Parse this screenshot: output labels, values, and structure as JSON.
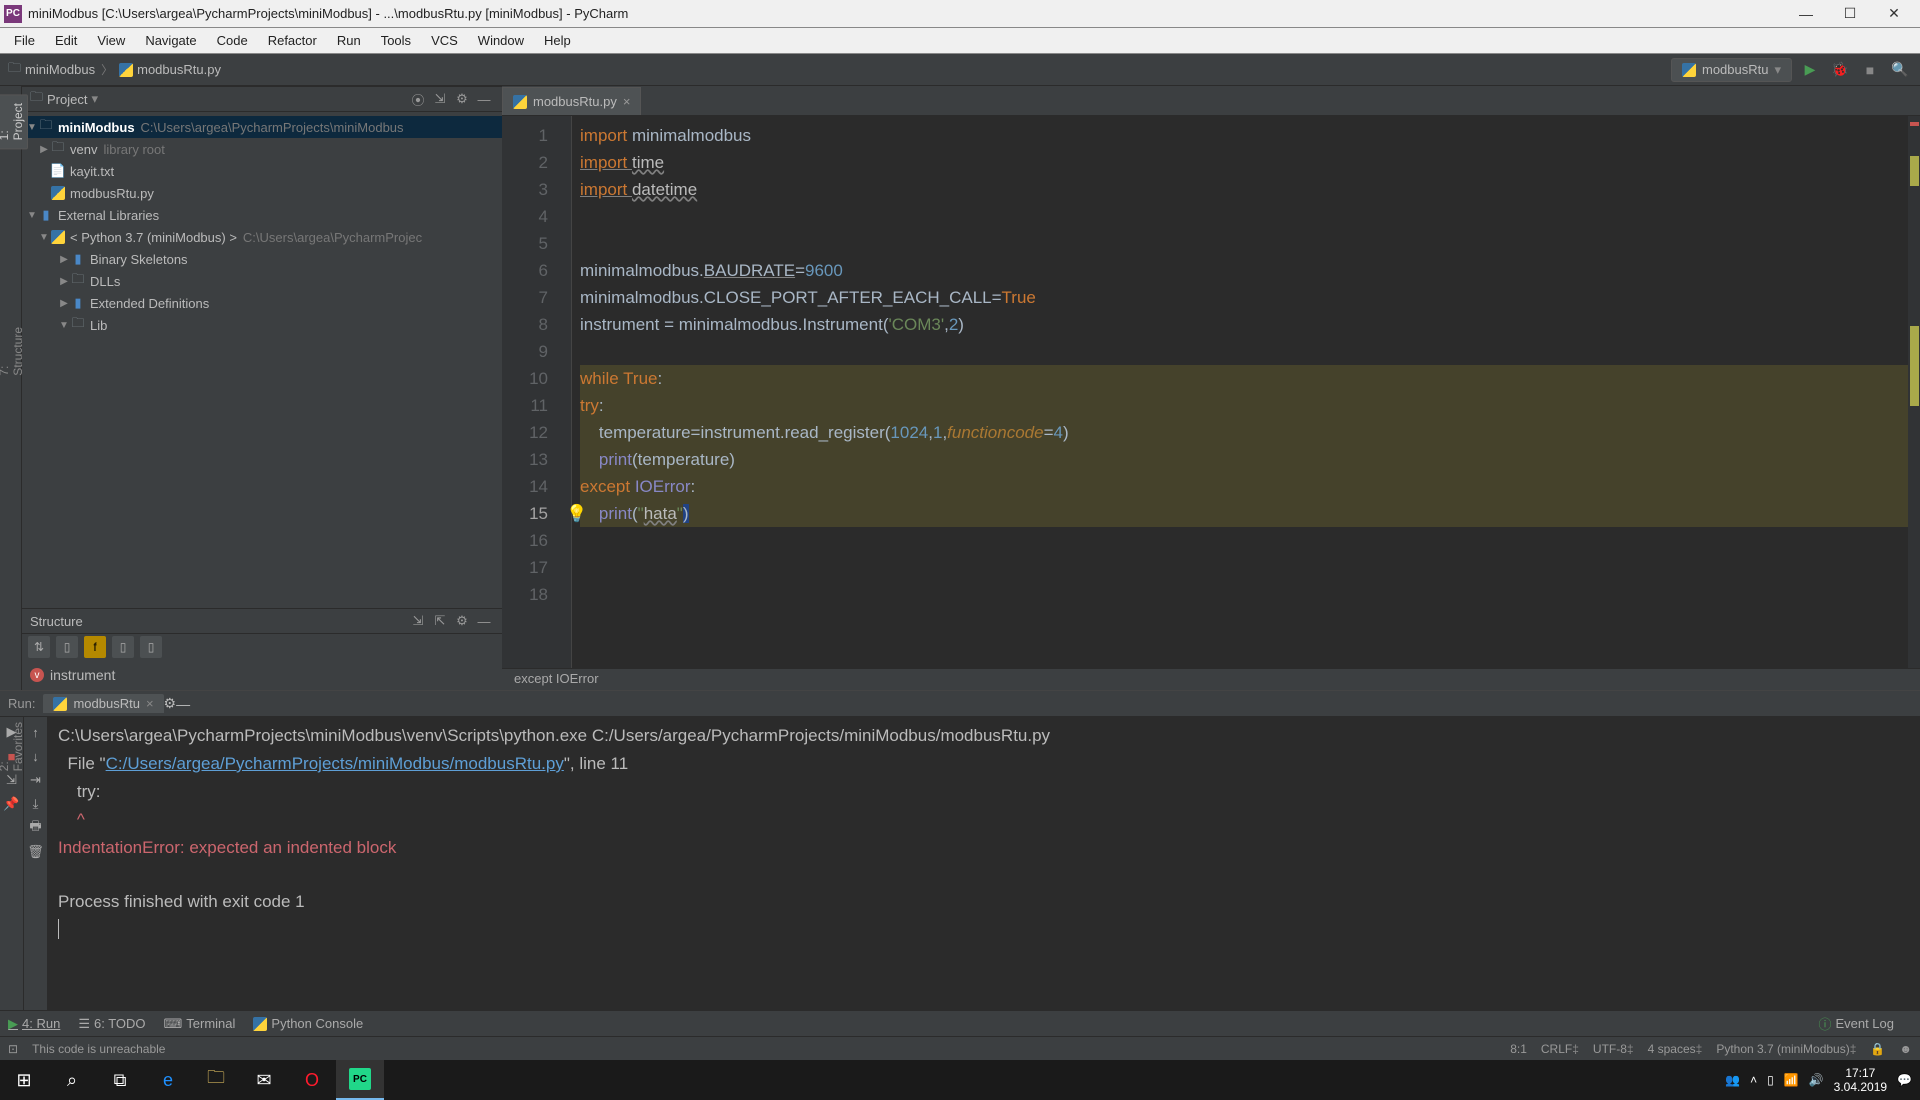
{
  "window": {
    "title": "miniModbus [C:\\Users\\argea\\PycharmProjects\\miniModbus] - ...\\modbusRtu.py [miniModbus] - PyCharm"
  },
  "menu": [
    "File",
    "Edit",
    "View",
    "Navigate",
    "Code",
    "Refactor",
    "Run",
    "Tools",
    "VCS",
    "Window",
    "Help"
  ],
  "breadcrumb": {
    "a": "miniModbus",
    "b": "modbusRtu.py"
  },
  "runcfg": "modbusRtu",
  "project": {
    "title": "Project",
    "root": {
      "name": "miniModbus",
      "path": "C:\\Users\\argea\\PycharmProjects\\miniModbus"
    },
    "venv": {
      "name": "venv",
      "note": "library root"
    },
    "kayit": "kayit.txt",
    "modbus": "modbusRtu.py",
    "extlib": "External Libraries",
    "python": {
      "name": "< Python 3.7 (miniModbus) >",
      "path": "C:\\Users\\argea\\PycharmProjec"
    },
    "binskel": "Binary Skeletons",
    "dlls": "DLLs",
    "extdef": "Extended Definitions",
    "lib": "Lib"
  },
  "structure": {
    "title": "Structure",
    "item": "instrument"
  },
  "tab": {
    "name": "modbusRtu.py"
  },
  "code": {
    "lines": [
      1,
      2,
      3,
      4,
      5,
      6,
      7,
      8,
      9,
      10,
      11,
      12,
      13,
      14,
      15,
      16,
      17,
      18
    ],
    "l1a": "import ",
    "l1b": "minimalmodbus",
    "l2a": "import ",
    "l2b": "time",
    "l3a": "import ",
    "l3b": "datetime",
    "l6": "minimalmodbus.",
    "l6b": "BAUDRATE",
    "l6c": "=",
    "l6d": "9600",
    "l7": "minimalmodbus.CLOSE_PORT_AFTER_EACH_CALL=",
    "l7b": "True",
    "l8": "instrument = minimalmodbus.Instrument(",
    "l8b": "'COM3'",
    "l8c": ",",
    "l8d": "2",
    "l8e": ")",
    "l10a": "while ",
    "l10b": "True",
    "l10c": ":",
    "l11a": "try",
    "l11b": ":",
    "l12a": "    temperature=instrument.read_register(",
    "l12b": "1024",
    "l12c": ",",
    "l12d": "1",
    "l12e": ",",
    "l12f": "functioncode",
    "l12g": "=",
    "l12h": "4",
    "l12i": ")",
    "l13a": "    ",
    "l13b": "print",
    "l13c": "(temperature)",
    "l14a": "except ",
    "l14b": "IOError",
    "l14c": ":",
    "l15a": "    ",
    "l15b": "print",
    "l15c": "(",
    "l15d": "\"",
    "l15e": "hata",
    "l15f": "\"",
    "l15g": ")"
  },
  "crumb2": "except IOError",
  "run": {
    "label": "Run:",
    "tab": "modbusRtu",
    "line1": "C:\\Users\\argea\\PycharmProjects\\miniModbus\\venv\\Scripts\\python.exe C:/Users/argea/PycharmProjects/miniModbus/modbusRtu.py",
    "line2a": "  File \"",
    "line2link": "C:/Users/argea/PycharmProjects/miniModbus/modbusRtu.py",
    "line2b": "\", line 11",
    "line3": "    try:",
    "line4": "    ^",
    "line5": "IndentationError: expected an indented block",
    "line6": "",
    "line7": "Process finished with exit code 1"
  },
  "bottombar": {
    "run": "4: Run",
    "todo": "6: TODO",
    "terminal": "Terminal",
    "pyconsole": "Python Console",
    "eventlog": "Event Log"
  },
  "status": {
    "msg": "This code is unreachable",
    "pos": "8:1",
    "crlf": "CRLF",
    "enc": "UTF-8",
    "indent": "4 spaces",
    "python": "Python 3.7 (miniModbus)"
  },
  "leftedge": {
    "project": "1: Project",
    "structure": "7: Structure",
    "fav": "2: Favorites"
  },
  "tray": {
    "time": "17:17",
    "date": "3.04.2019"
  }
}
